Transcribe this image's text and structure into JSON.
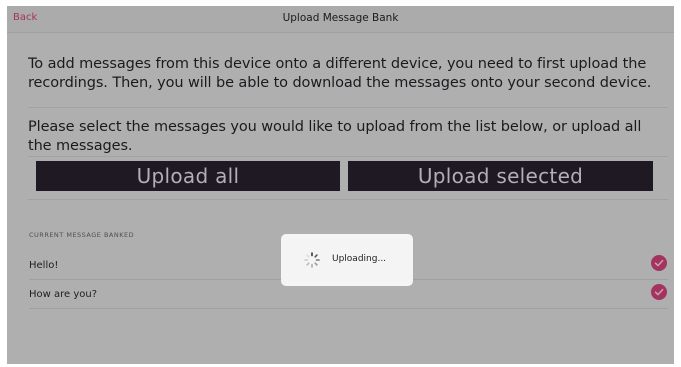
{
  "navbar": {
    "back_label": "Back",
    "title": "Upload Message Bank"
  },
  "intro": {
    "paragraph_1": "To add messages from this device onto a different device, you need to first upload the recordings. Then, you will be able to download the messages onto your second device.",
    "paragraph_2": "Please select the messages you would like to upload from the list below, or upload all the messages."
  },
  "buttons": {
    "upload_all": "Upload all",
    "upload_selected": "Upload selected"
  },
  "list": {
    "header": "CURRENT MESSAGE BANKED",
    "items": [
      {
        "label": "Hello!",
        "selected": true
      },
      {
        "label": "How are you?",
        "selected": true
      }
    ]
  },
  "toast": {
    "label": "Uploading...",
    "icon": "loading-spinner-icon"
  },
  "colors": {
    "accent": "#a3335f",
    "button_bg": "#1e1922",
    "overlay_bg": "#b0afb0"
  }
}
